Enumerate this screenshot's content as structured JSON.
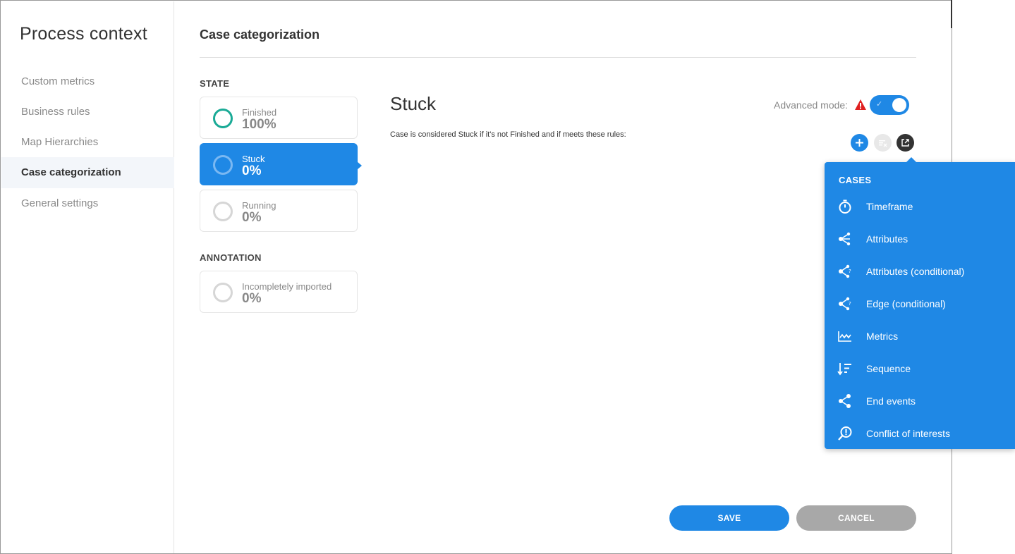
{
  "sidebar": {
    "title": "Process context",
    "items": [
      {
        "label": "Custom metrics"
      },
      {
        "label": "Business rules"
      },
      {
        "label": "Map Hierarchies"
      },
      {
        "label": "Case categorization"
      },
      {
        "label": "General settings"
      }
    ],
    "active_item": "Case categorization"
  },
  "main": {
    "title": "Case categorization",
    "state_section": "STATE",
    "states": [
      {
        "name": "Finished",
        "percent": "100%"
      },
      {
        "name": "Stuck",
        "percent": "0%"
      },
      {
        "name": "Running",
        "percent": "0%"
      }
    ],
    "annotation_section": "ANNOTATION",
    "annotations": [
      {
        "name": "Incompletely imported",
        "percent": "0%"
      }
    ]
  },
  "detail": {
    "title": "Stuck",
    "description": "Case is considered Stuck if it's not Finished and if meets these rules:",
    "advanced_mode_label": "Advanced mode:",
    "advanced_mode_on": true
  },
  "menu": {
    "header": "CASES",
    "items": [
      {
        "label": "Timeframe",
        "icon": "stopwatch-icon"
      },
      {
        "label": "Attributes",
        "icon": "attributes-icon"
      },
      {
        "label": "Attributes (conditional)",
        "icon": "attributes-conditional-icon"
      },
      {
        "label": "Edge (conditional)",
        "icon": "edge-conditional-icon"
      },
      {
        "label": "Metrics",
        "icon": "metrics-icon"
      },
      {
        "label": "Sequence",
        "icon": "sequence-icon"
      },
      {
        "label": "End events",
        "icon": "end-events-icon"
      },
      {
        "label": "Conflict of interests",
        "icon": "conflict-icon"
      }
    ]
  },
  "buttons": {
    "save": "SAVE",
    "cancel": "CANCEL"
  },
  "colors": {
    "accent": "#1f88e5",
    "finished_ring": "#1aaa96",
    "warning": "#e02020",
    "cancel_button": "#a8a8a8"
  }
}
